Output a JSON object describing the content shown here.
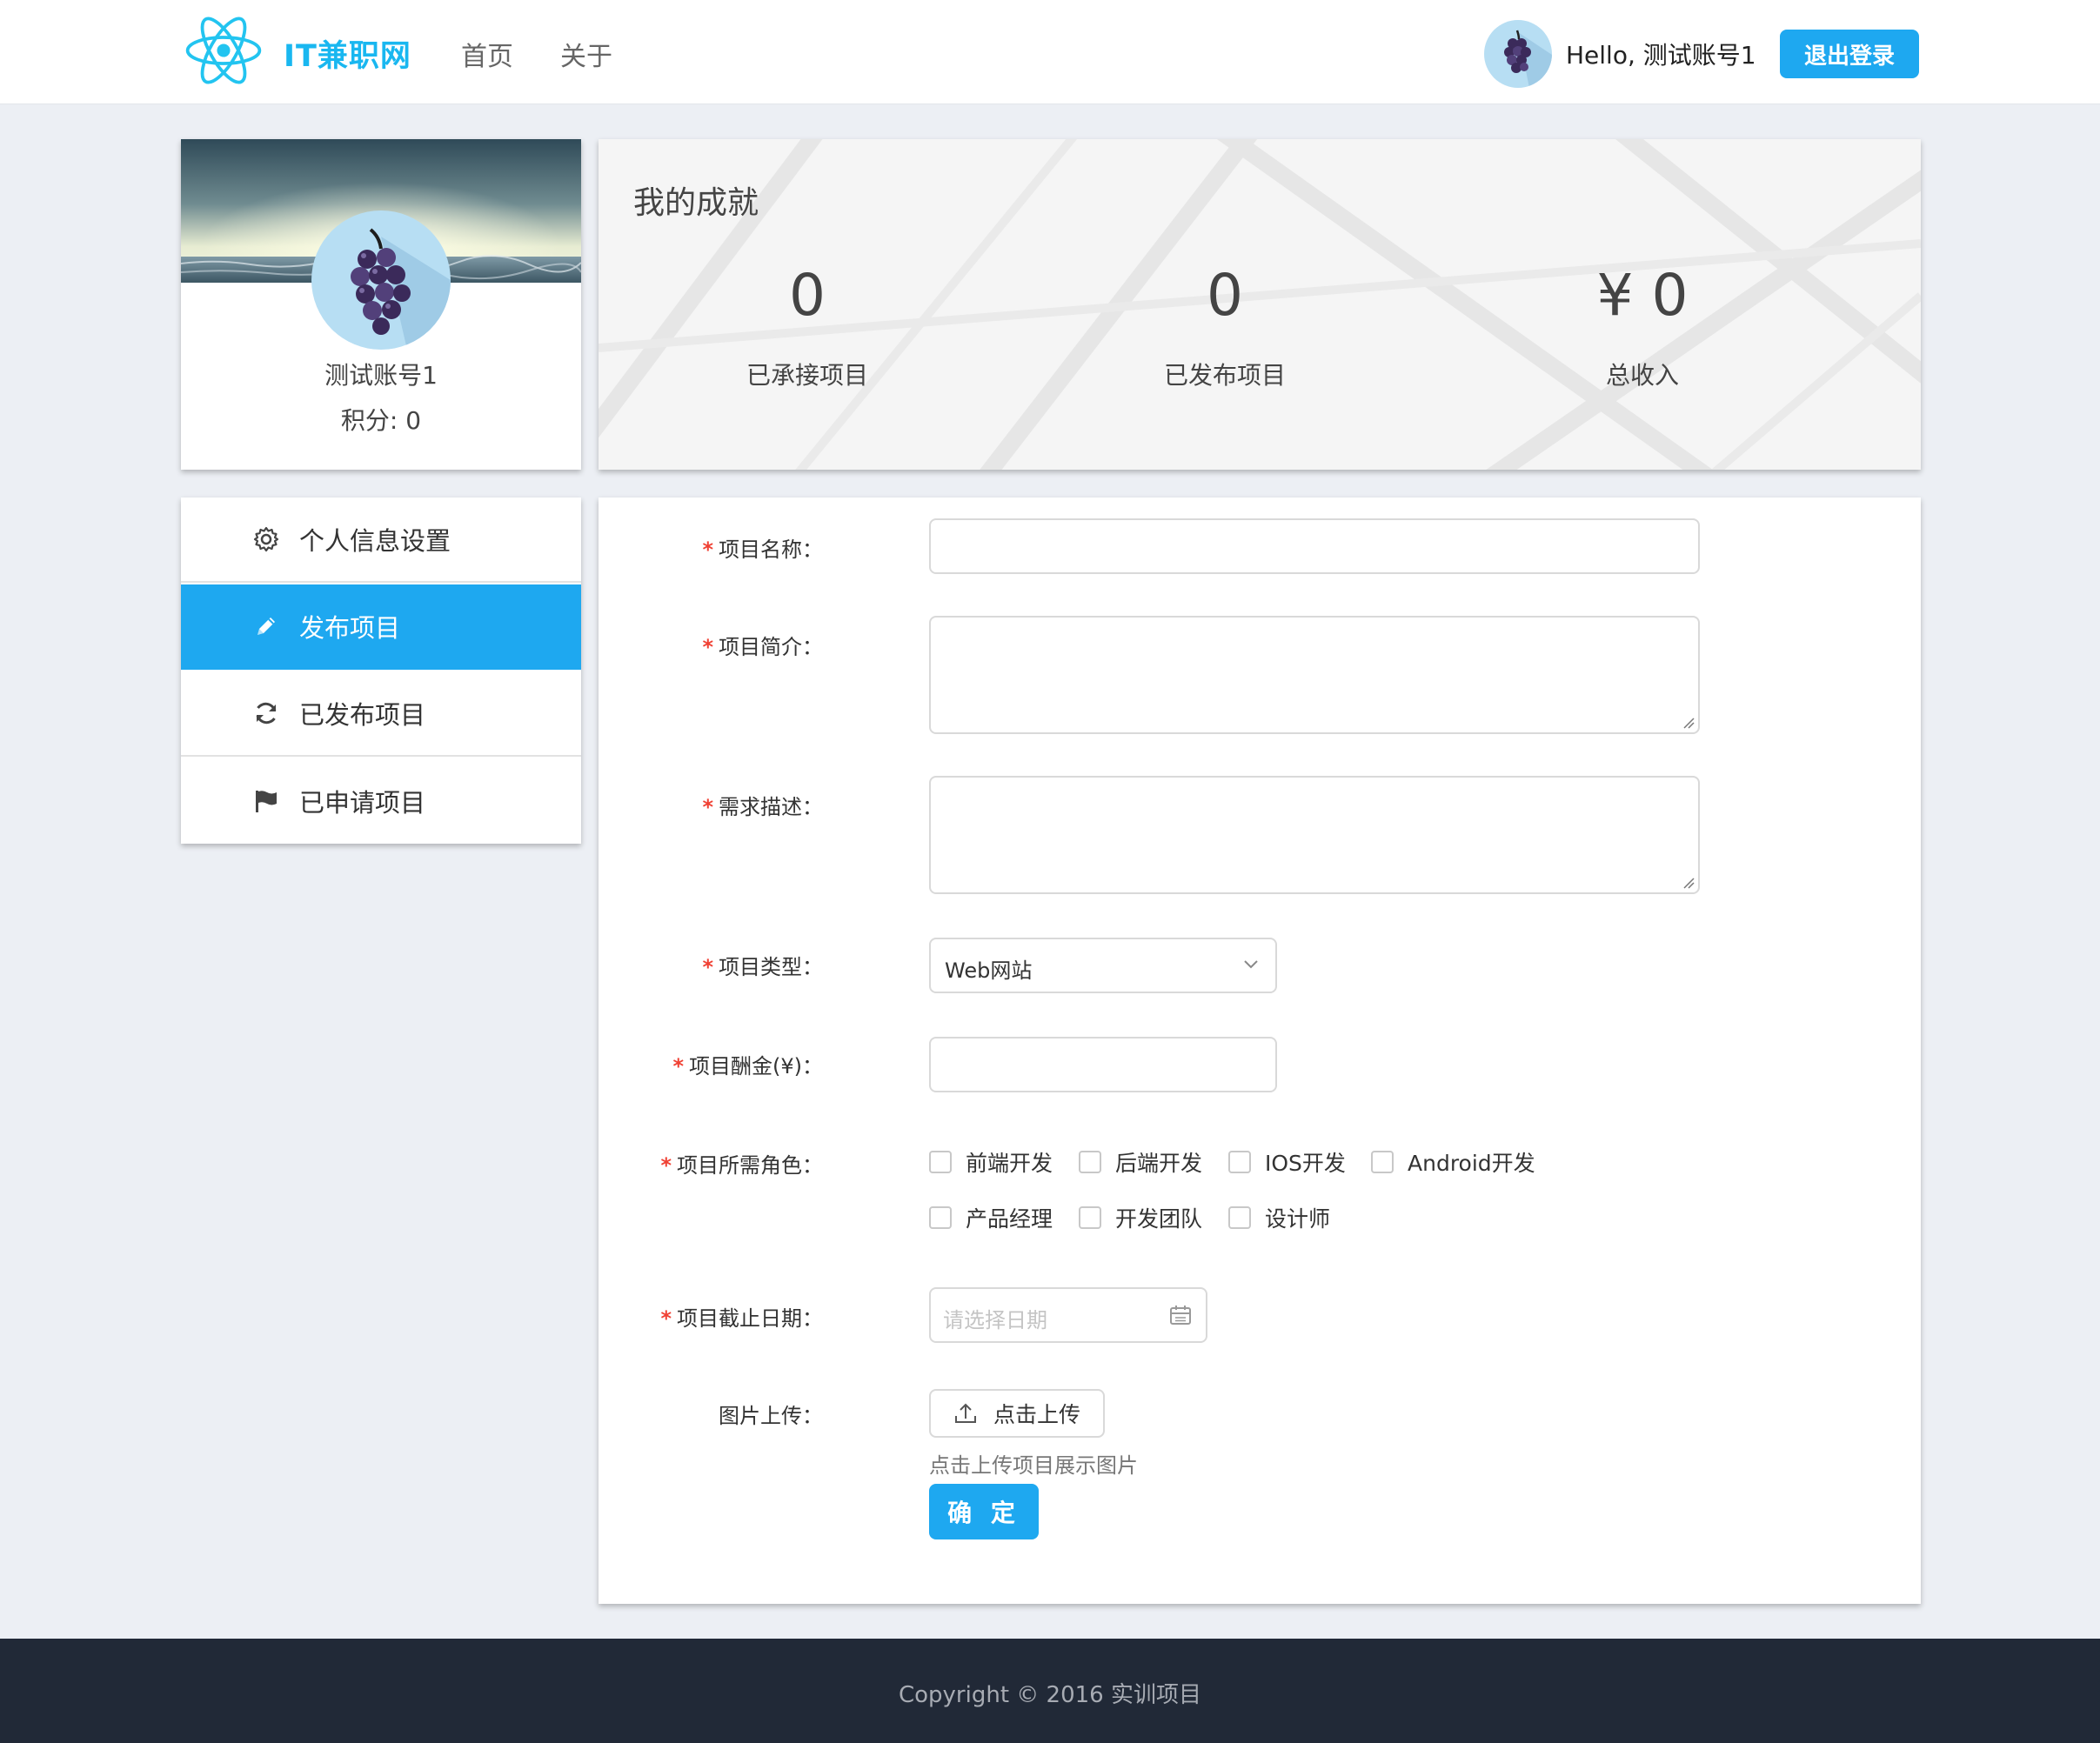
{
  "header": {
    "brand": "IT兼职网",
    "nav": [
      {
        "label": "首页"
      },
      {
        "label": "关于"
      }
    ],
    "greeting": "Hello, 测试账号1",
    "logout_label": "退出登录"
  },
  "profile": {
    "name": "测试账号1",
    "score": "积分: 0"
  },
  "achievements": {
    "title": "我的成就",
    "stats": [
      {
        "value": "0",
        "label": "已承接项目"
      },
      {
        "value": "0",
        "label": "已发布项目"
      },
      {
        "value": "¥ 0",
        "label": "总收入"
      }
    ]
  },
  "menu": [
    {
      "label": "个人信息设置",
      "icon": "gear-icon"
    },
    {
      "label": "发布项目",
      "icon": "pencil-icon"
    },
    {
      "label": "已发布项目",
      "icon": "refresh-icon"
    },
    {
      "label": "已申请项目",
      "icon": "flag-icon"
    }
  ],
  "form": {
    "name_label": "项目名称：",
    "name_value": "",
    "intro_label": "项目简介：",
    "intro_value": "",
    "requirement_label": "需求描述：",
    "requirement_value": "",
    "type_label": "项目类型：",
    "type_value": "Web网站",
    "reward_label": "项目酬金(¥)：",
    "reward_value": "",
    "roles_label": "项目所需角色：",
    "roles": [
      "前端开发",
      "后端开发",
      "IOS开发",
      "Android开发",
      "产品经理",
      "开发团队",
      "设计师"
    ],
    "deadline_label": "项目截止日期：",
    "deadline_placeholder": "请选择日期",
    "upload_label": "图片上传：",
    "upload_button": "点击上传",
    "upload_hint": "点击上传项目展示图片",
    "submit_label": "确 定",
    "required_mark": "*"
  },
  "footer": {
    "copyright": "Copyright © 2016 实训项目"
  },
  "colors": {
    "accent": "#1ea8f0",
    "brand": "#19b7f0",
    "footer_bg": "#212937",
    "required": "#f04134"
  }
}
